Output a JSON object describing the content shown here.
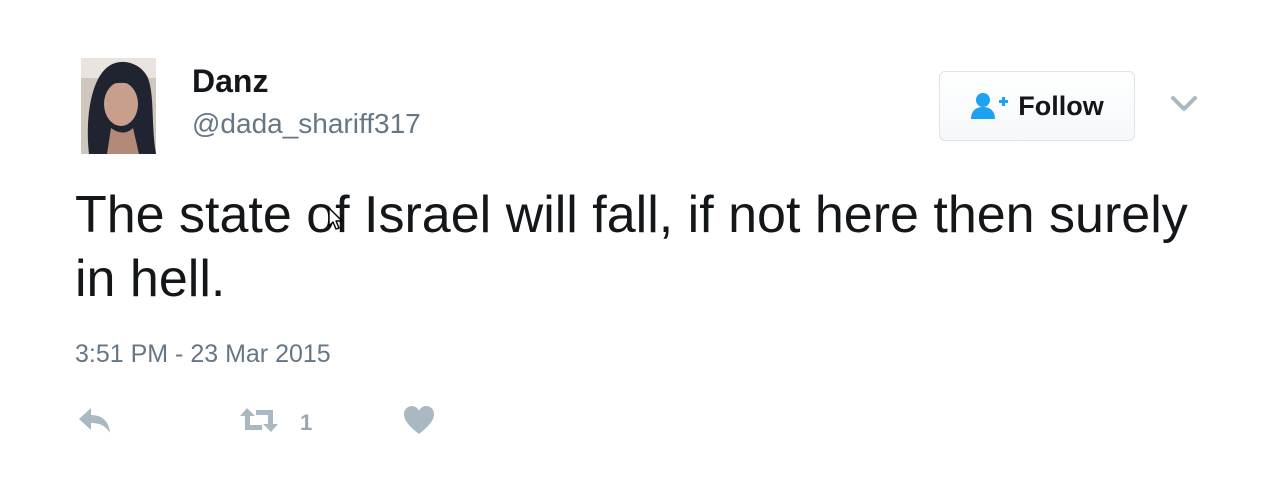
{
  "tweet": {
    "display_name": "Danz",
    "screen_name": "@dada_shariff317",
    "text": "The state of Israel will fall, if not here then surely in hell.",
    "timestamp": "3:51 PM - 23 Mar 2015"
  },
  "follow_button": {
    "label": "Follow",
    "icon": "add-user-icon"
  },
  "menu": {
    "icon": "chevron-down-icon"
  },
  "actions": {
    "reply_icon": "reply-icon",
    "retweet_icon": "retweet-icon",
    "retweet_count": "1",
    "like_icon": "heart-icon"
  },
  "colors": {
    "text": "#14171a",
    "secondary": "#657786",
    "icon_gray": "#aab8c2",
    "accent_blue": "#1da1f2"
  }
}
